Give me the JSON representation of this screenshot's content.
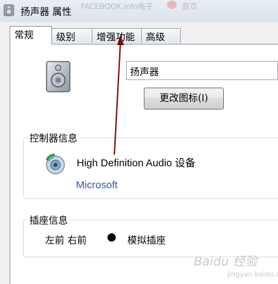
{
  "window": {
    "title": "扬声器 属性",
    "background_text_1": "FACEBOOK.info电子",
    "background_text_2": "首页"
  },
  "tabs": [
    {
      "label": "常规",
      "active": true
    },
    {
      "label": "级别",
      "active": false
    },
    {
      "label": "增强功能",
      "active": false
    },
    {
      "label": "高级",
      "active": false
    }
  ],
  "general": {
    "device_name_value": "扬声器",
    "change_icon_button": "更改图标(I)"
  },
  "controller": {
    "group_title": "控制器信息",
    "device": "High Definition Audio 设备",
    "vendor": "Microsoft"
  },
  "jack": {
    "group_title": "插座信息",
    "position": "左前 右前",
    "type": "模拟插座"
  },
  "annotation": {
    "color": "#7a1010"
  },
  "watermark": {
    "text": "Baidu 经验",
    "sub": "jingyan.baidu.com"
  },
  "colors": {
    "vendor_link": "#2a5ba8",
    "panel_border": "#8e98a3"
  }
}
